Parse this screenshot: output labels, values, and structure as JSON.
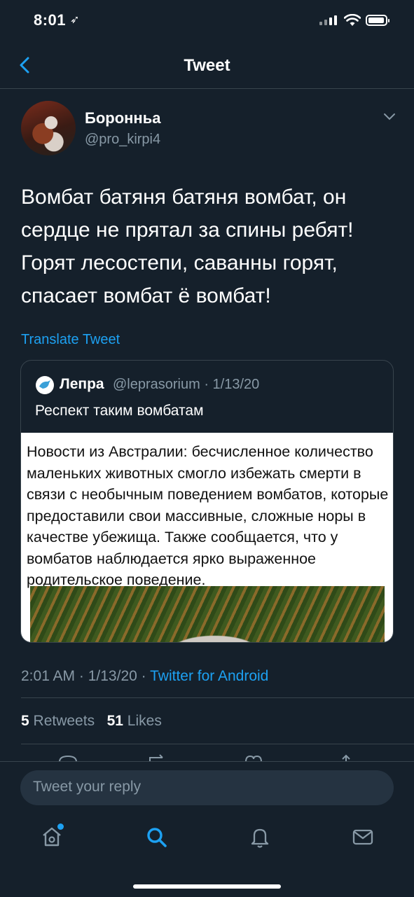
{
  "status_bar": {
    "time": "8:01",
    "location_arrow": "➶"
  },
  "header": {
    "title": "Tweet",
    "back_icon": "chevron-left-icon"
  },
  "tweet": {
    "author_name": "Боронньа",
    "author_handle": "@pro_kirpi4",
    "text": "Вомбат батяня батяня вомбат, он сердце не прятал за спины ребят! Горят лесостепи, саванны горят, спасает вомбат ё вомбат!",
    "translate_label": "Translate Tweet",
    "time": "2:01 AM",
    "date": "1/13/20",
    "source": "Twitter for Android",
    "retweets_count": "5",
    "retweets_label": "Retweets",
    "likes_count": "51",
    "likes_label": "Likes"
  },
  "quote": {
    "name": "Лепра",
    "handle_date": "@leprasorium · 1/13/20",
    "text": "Респект таким вомбатам",
    "media_text": "Новости из Австралии: бесчисленное количество маленьких животных смогло избежать смерти в связи с необычным поведением вомбатов, которые предоставили свои массивные, сложные норы в качестве убежища. Также сообщается, что у вомбатов наблюдается ярко выраженное родительское поведение."
  },
  "reply": {
    "placeholder": "Tweet your reply"
  },
  "tab_bar": {
    "items": [
      "home-icon",
      "search-icon",
      "notifications-icon",
      "messages-icon"
    ]
  },
  "colors": {
    "background": "#15202b",
    "accent": "#1da1f2",
    "secondary_text": "#8899a6",
    "divider": "#38444d"
  }
}
